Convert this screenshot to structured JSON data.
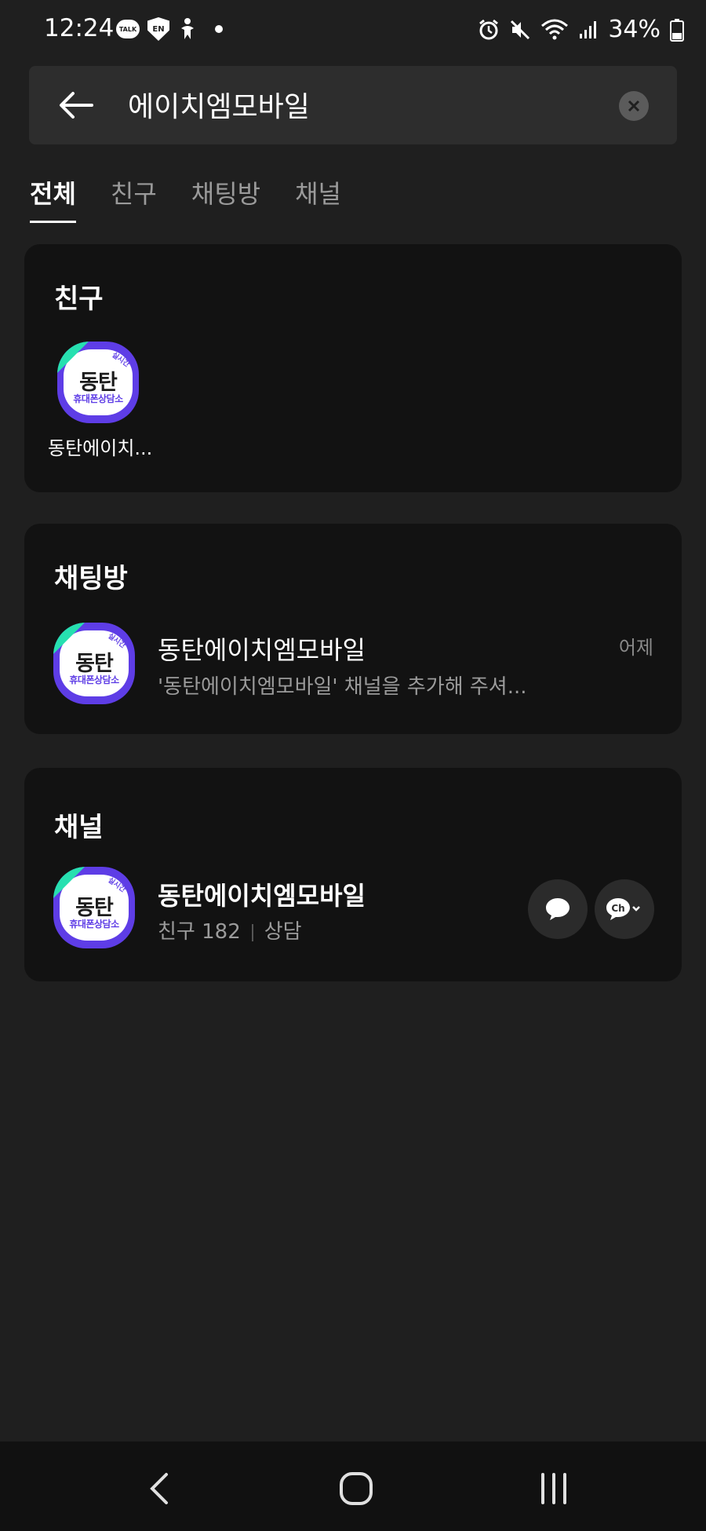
{
  "status_bar": {
    "time": "12:24",
    "talk_icon_label": "TALK",
    "shield_icon_label": "EN",
    "battery": "34%"
  },
  "search": {
    "query": "에이치엠모바일"
  },
  "tabs": [
    {
      "label": "전체",
      "active": true
    },
    {
      "label": "친구",
      "active": false
    },
    {
      "label": "채팅방",
      "active": false
    },
    {
      "label": "채널",
      "active": false
    }
  ],
  "logo": {
    "big": "동탄",
    "small": "휴대폰상담소",
    "badge": "실시간"
  },
  "friends_section": {
    "title": "친구",
    "items": [
      {
        "name": "동탄에이치..."
      }
    ]
  },
  "chats_section": {
    "title": "채팅방",
    "items": [
      {
        "name": "동탄에이치엠모바일",
        "preview": "'동탄에이치엠모바일' 채널을 추가해 주셔...",
        "time": "어제"
      }
    ]
  },
  "channels_section": {
    "title": "채널",
    "items": [
      {
        "name": "동탄에이치엠모바일",
        "friends_label": "친구 182",
        "category": "상담",
        "channel_icon_label": "Ch"
      }
    ]
  },
  "colors": {
    "background": "#1f1f1f",
    "card": "#121212",
    "logo_purple": "#5e3de6",
    "logo_teal": "#27e0b0"
  }
}
